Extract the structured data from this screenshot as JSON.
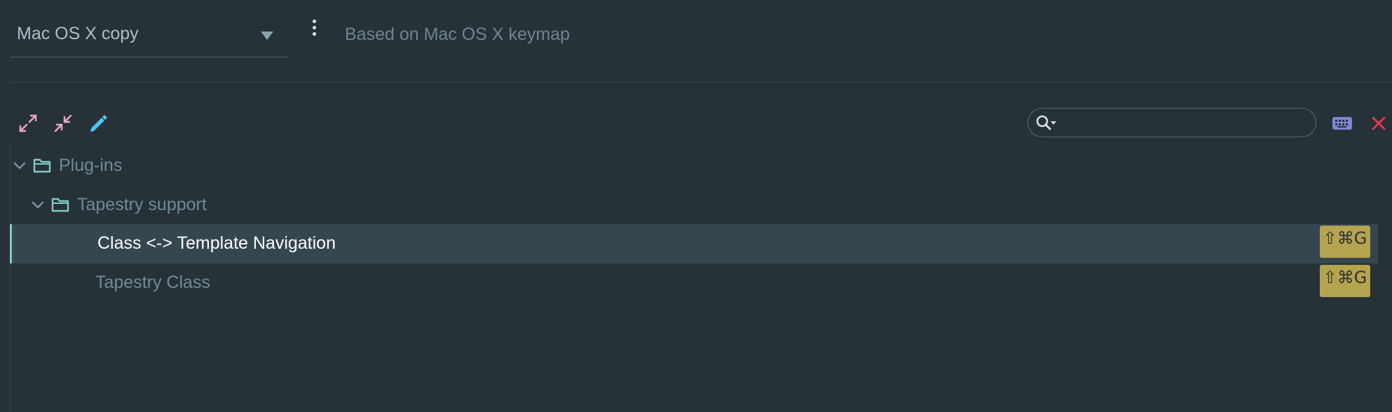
{
  "keymap": {
    "selected": "Mac OS X copy",
    "based_on": "Based on Mac OS X keymap"
  },
  "toolbar": {
    "expand_all_icon": "expand-all-icon",
    "collapse_all_icon": "collapse-all-icon",
    "edit_icon": "pencil-icon",
    "search_placeholder": "",
    "search_value": "",
    "find_by_shortcut_icon": "keyboard-icon",
    "clear_filter_icon": "close-icon"
  },
  "tree": {
    "plugins": {
      "label": "Plug-ins",
      "expanded": true
    },
    "tapestry": {
      "label": "Tapestry support",
      "expanded": true
    },
    "actions": [
      {
        "label": "Class <-> Template Navigation",
        "shortcut": "⇧⌘G",
        "selected": true
      },
      {
        "label": "Tapestry Class",
        "shortcut": "⇧⌘G",
        "selected": false
      }
    ]
  },
  "colors": {
    "background": "#263238",
    "selection": "#34464f",
    "accent": "#80cbc4",
    "shortcut_badge": "#b5a44e",
    "expand_icon": "#f0a8c6",
    "edit_icon": "#4fc3f7",
    "keyboard_icon": "#7e86d6",
    "close_icon": "#e53950"
  }
}
